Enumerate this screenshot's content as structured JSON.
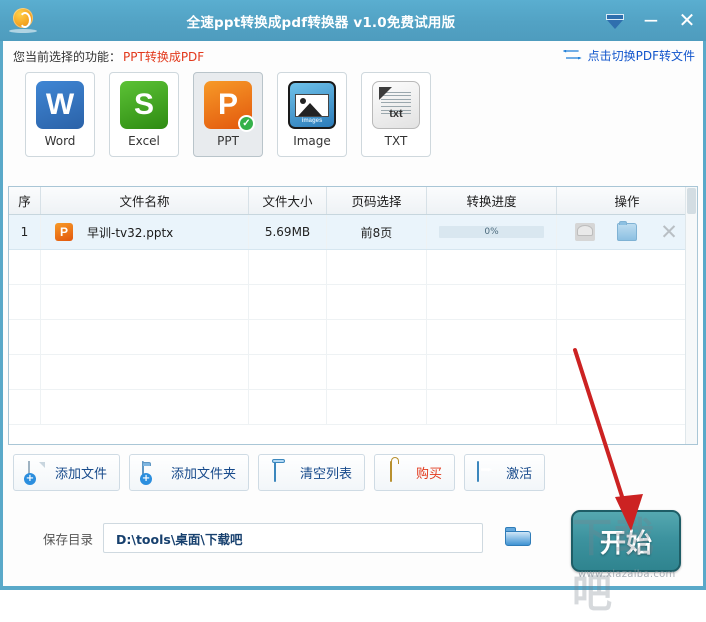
{
  "window": {
    "title": "全速ppt转换成pdf转换器 v1.0免费试用版",
    "logo_icon": "app-logo-icon",
    "controls": {
      "skin": "skin-chevron-down-icon",
      "minimize": "−",
      "close": "✕"
    }
  },
  "funcbar": {
    "label": "您当前选择的功能：",
    "value": "PPT转换成PDF",
    "switch_link": "点击切换PDF转文件",
    "switch_icon": "swap-arrows-icon"
  },
  "formats": [
    {
      "caption": "Word",
      "glyph": "W",
      "icon": "word-icon",
      "selected": false,
      "checked": false
    },
    {
      "caption": "Excel",
      "glyph": "S",
      "icon": "excel-icon",
      "selected": false,
      "checked": false
    },
    {
      "caption": "PPT",
      "glyph": "P",
      "icon": "ppt-icon",
      "selected": true,
      "checked": true
    },
    {
      "caption": "Image",
      "glyph": "",
      "icon": "image-icon",
      "selected": false,
      "checked": false
    },
    {
      "caption": "TXT",
      "glyph": "",
      "icon": "txt-icon",
      "selected": false,
      "checked": false
    }
  ],
  "format_extra": {
    "image_inner_label": "images",
    "txt_word": "txt",
    "check_glyph": "✓"
  },
  "table": {
    "headers": [
      "序",
      "文件名称",
      "文件大小",
      "页码选择",
      "转换进度",
      "操作"
    ],
    "rows": [
      {
        "index": "1",
        "file_icon": "ppt-file-icon",
        "file_icon_glyph": "P",
        "name": "早训-tv32.pptx",
        "size": "5.69MB",
        "pages": "前8页",
        "progress": "0%",
        "progress_value": 0,
        "actions": [
          "preview-icon",
          "open-folder-icon",
          "remove-icon"
        ],
        "remove_glyph": "✕"
      }
    ]
  },
  "toolbar": [
    {
      "label": "添加文件",
      "icon": "add-file-icon",
      "red": false,
      "plus": "+"
    },
    {
      "label": "添加文件夹",
      "icon": "add-folder-icon",
      "red": false,
      "plus": "+"
    },
    {
      "label": "清空列表",
      "icon": "clear-list-icon",
      "red": false,
      "plus": ""
    },
    {
      "label": "购买",
      "icon": "purchase-icon",
      "red": true,
      "plus": ""
    },
    {
      "label": "激活",
      "icon": "activate-icon",
      "red": false,
      "plus": ""
    }
  ],
  "save": {
    "label": "保存目录",
    "path": "D:\\tools\\桌面\\下载吧",
    "placeholder": "D:\\tools\\桌面\\下载吧",
    "browse_icon": "browse-folder-icon"
  },
  "start_button": {
    "label": "开始"
  },
  "annotation": {
    "arrow_icon": "red-pointer-arrow",
    "color": "#cc2222"
  },
  "watermark": {
    "mark": "下载吧",
    "url": "www.xiazaiba.com"
  },
  "colors": {
    "titlebar": "#52a2c4",
    "accent_red": "#e2391c",
    "link_blue": "#1155cc",
    "start_teal": "#3d939f"
  }
}
